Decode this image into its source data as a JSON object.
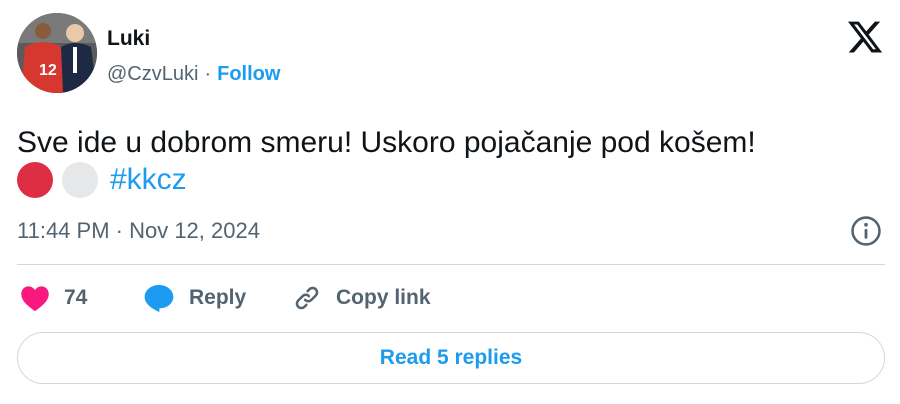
{
  "author": {
    "name": "Luki",
    "handle": "@CzvLuki",
    "separator": "·",
    "follow_label": "Follow",
    "avatar_icon": "profile-photo",
    "jersey_number": "12"
  },
  "platform_icon": "x-logo-icon",
  "tweet": {
    "text": "Sve ide u dobrom smeru! Uskoro pojačanje pod košem!",
    "emojis": [
      {
        "name": "red-circle-emoji",
        "color": "#dd2e44"
      },
      {
        "name": "white-circle-emoji",
        "color": "#e6e7e8"
      }
    ],
    "hashtag": "#kkcz"
  },
  "timestamp": "11:44 PM · Nov 12, 2024",
  "actions": {
    "like_count": "74",
    "reply_label": "Reply",
    "copy_link_label": "Copy link"
  },
  "read_replies_label": "Read 5 replies",
  "colors": {
    "accent": "#1d9bf0",
    "like": "#f91880",
    "muted": "#536471",
    "text": "#0f1419",
    "border": "#cfd9de"
  }
}
